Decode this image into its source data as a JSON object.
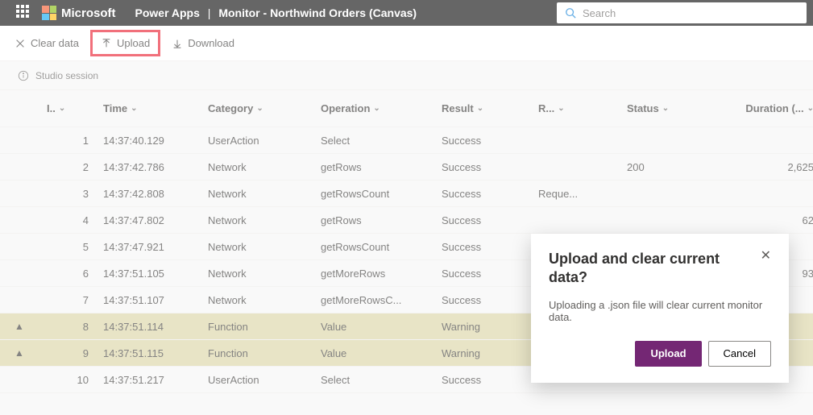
{
  "header": {
    "brand": "Microsoft",
    "app": "Power Apps",
    "page": "Monitor - Northwind Orders (Canvas)",
    "search_placeholder": "Search"
  },
  "toolbar": {
    "clear_data": "Clear data",
    "upload": "Upload",
    "download": "Download"
  },
  "session_label": "Studio session",
  "columns": {
    "warn": "",
    "id": "I..",
    "time": "Time",
    "category": "Category",
    "operation": "Operation",
    "result": "Result",
    "r": "R...",
    "status": "Status",
    "duration": "Duration (..."
  },
  "rows": [
    {
      "warn": "",
      "id": "1",
      "time": "14:37:40.129",
      "category": "UserAction",
      "operation": "Select",
      "result": "Success",
      "r": "",
      "status": "",
      "duration": ""
    },
    {
      "warn": "",
      "id": "2",
      "time": "14:37:42.786",
      "category": "Network",
      "operation": "getRows",
      "result": "Success",
      "r": "",
      "status": "200",
      "duration": "2,625"
    },
    {
      "warn": "",
      "id": "3",
      "time": "14:37:42.808",
      "category": "Network",
      "operation": "getRowsCount",
      "result": "Success",
      "r": "Reque...",
      "status": "",
      "duration": ""
    },
    {
      "warn": "",
      "id": "4",
      "time": "14:37:47.802",
      "category": "Network",
      "operation": "getRows",
      "result": "Success",
      "r": "",
      "status": "",
      "duration": "62"
    },
    {
      "warn": "",
      "id": "5",
      "time": "14:37:47.921",
      "category": "Network",
      "operation": "getRowsCount",
      "result": "Success",
      "r": "",
      "status": "",
      "duration": ""
    },
    {
      "warn": "",
      "id": "6",
      "time": "14:37:51.105",
      "category": "Network",
      "operation": "getMoreRows",
      "result": "Success",
      "r": "",
      "status": "",
      "duration": "93"
    },
    {
      "warn": "",
      "id": "7",
      "time": "14:37:51.107",
      "category": "Network",
      "operation": "getMoreRowsC...",
      "result": "Success",
      "r": "",
      "status": "",
      "duration": ""
    },
    {
      "warn": "▲",
      "id": "8",
      "time": "14:37:51.114",
      "category": "Function",
      "operation": "Value",
      "result": "Warning",
      "r": "",
      "status": "",
      "duration": ""
    },
    {
      "warn": "▲",
      "id": "9",
      "time": "14:37:51.115",
      "category": "Function",
      "operation": "Value",
      "result": "Warning",
      "r": "",
      "status": "",
      "duration": ""
    },
    {
      "warn": "",
      "id": "10",
      "time": "14:37:51.217",
      "category": "UserAction",
      "operation": "Select",
      "result": "Success",
      "r": "",
      "status": "",
      "duration": ""
    }
  ],
  "dialog": {
    "title": "Upload and clear current data?",
    "body": "Uploading a .json file will clear current monitor data.",
    "upload": "Upload",
    "cancel": "Cancel"
  }
}
